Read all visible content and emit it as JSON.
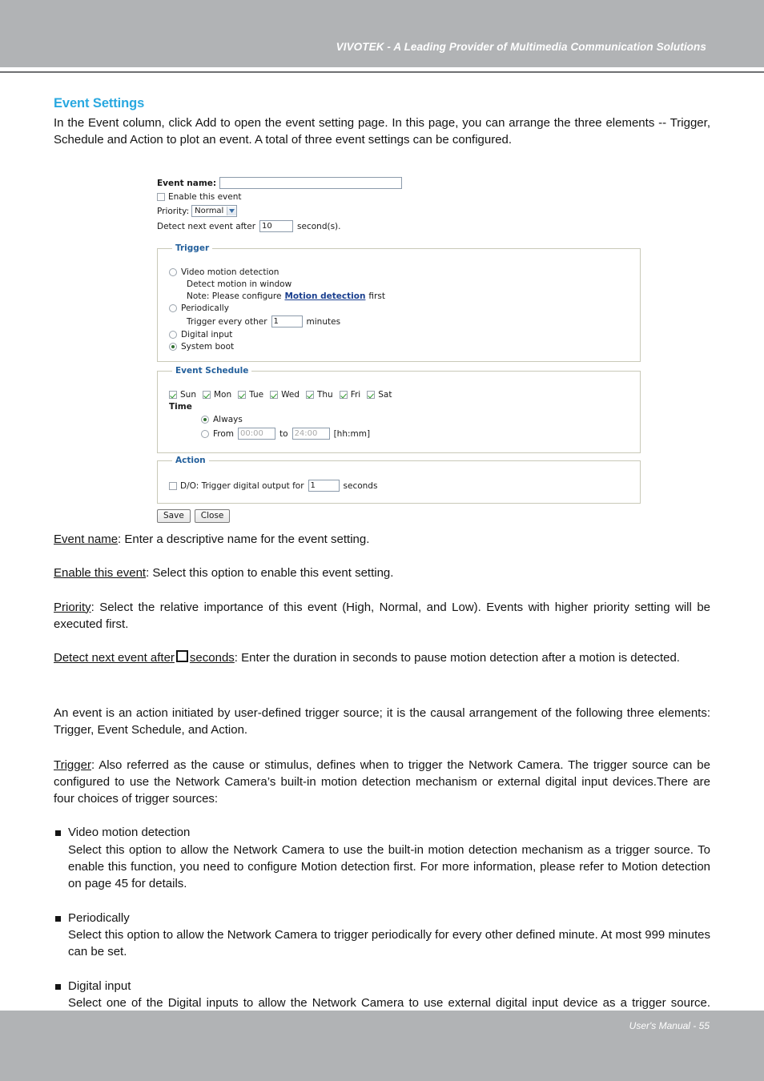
{
  "page": {
    "header_title": "VIVOTEK - A Leading Provider of Multimedia Communication Solutions",
    "footer_text": "User's Manual - 55",
    "accent_heading_color": "#29a8e0",
    "band_color": "#b1b3b5"
  },
  "section": {
    "heading": "Event Settings",
    "intro": "In the Event column, click Add to open the event setting page. In this page, you can arrange the three elements -- Trigger, Schedule and Action to plot an event. A total of three event settings can be configured."
  },
  "screenshot": {
    "event_name": {
      "label": "Event name:",
      "value": "",
      "placeholder": ""
    },
    "enable_event": {
      "label": "Enable this event",
      "checked": false
    },
    "priority": {
      "label": "Priority:",
      "value": "Normal",
      "options": [
        "High",
        "Normal",
        "Low"
      ]
    },
    "detect_next": {
      "label_before": "Detect next event after",
      "value": "10",
      "label_after": "second(s)."
    },
    "trigger": {
      "legend": "Trigger",
      "options": [
        {
          "label": "Video motion detection",
          "selected": false
        },
        {
          "label": "Periodically",
          "selected": false
        },
        {
          "label": "Digital input",
          "selected": false
        },
        {
          "label": "System boot",
          "selected": true
        }
      ],
      "detect_motion_label": "Detect motion in window",
      "note_prefix": "Note: Please configure",
      "note_link": "Motion detection",
      "note_suffix": "first",
      "periodic_before": "Trigger every other",
      "periodic_value": "1",
      "periodic_after": "minutes"
    },
    "schedule": {
      "legend": "Event Schedule",
      "days": [
        {
          "label": "Sun",
          "checked": true
        },
        {
          "label": "Mon",
          "checked": true
        },
        {
          "label": "Tue",
          "checked": true
        },
        {
          "label": "Wed",
          "checked": true
        },
        {
          "label": "Thu",
          "checked": true
        },
        {
          "label": "Fri",
          "checked": true
        },
        {
          "label": "Sat",
          "checked": true
        }
      ],
      "time_label": "Time",
      "always_label": "Always",
      "always_selected": true,
      "from_label": "From",
      "from_value": "00:00",
      "to_label": "to",
      "to_value": "24:00",
      "format_hint": "[hh:mm]"
    },
    "action": {
      "legend": "Action",
      "do_checked": false,
      "do_before": "D/O: Trigger digital output for",
      "do_value": "1",
      "do_after": "seconds"
    },
    "buttons": {
      "save": "Save",
      "close": "Close"
    }
  },
  "definitions": [
    {
      "term": "Event name",
      "body": ": Enter a descriptive name for the event setting."
    },
    {
      "term": "Enable this event",
      "body": ": Select this option to enable this event setting."
    },
    {
      "term": "Priority",
      "body": ": Select the relative importance of this event (High, Normal, and Low). Events with higher priority setting will be executed first."
    }
  ],
  "detect_definition": {
    "term_before": "Detect next event after",
    "term_after": "seconds",
    "body": ": Enter the duration in seconds to pause motion detection after a motion is detected."
  },
  "paragraphs": {
    "event_is": "An event is an action initiated by user-defined trigger source; it is the causal arrangement of the following three elements: Trigger, Event Schedule, and Action.",
    "trigger_term": "Trigger",
    "trigger_body": ": Also referred as the cause or stimulus, defines when to trigger the Network Camera. The trigger source can be configured to use the Network Camera’s built-in motion detection mechanism or external digital input devices.There are four choices of trigger sources:"
  },
  "bullets": [
    {
      "title": "Video motion detection",
      "body": "Select this option to allow the Network Camera to use the built-in motion detection mechanism as a trigger source. To enable this function, you need to configure Motion detection first. For more information, please refer to Motion detection on page 45 for details."
    },
    {
      "title": "Periodically",
      "body": "Select this option to allow the Network Camera to trigger periodically for every other defined minute. At most 999 minutes can be set."
    },
    {
      "title": "Digital input",
      "body": "Select one of the Digital inputs to allow the Network Camera to use external digital input device as a trigger source. Depending on your applications, there are choices of digital input devices on the market"
    }
  ]
}
